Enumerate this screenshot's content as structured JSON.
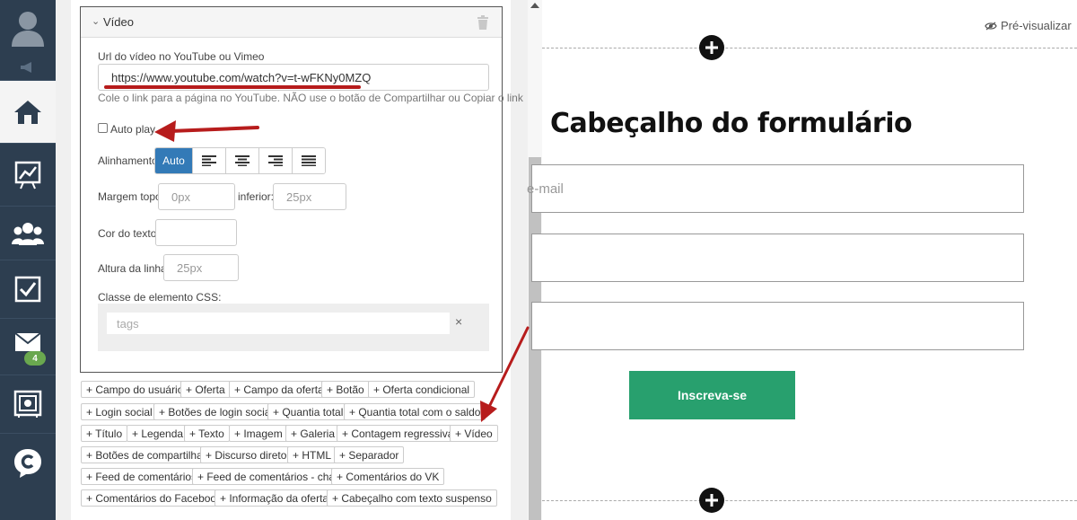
{
  "sidebar": {
    "items": [
      {
        "name": "avatar",
        "icon": "user-avatar-icon"
      },
      {
        "name": "announce",
        "icon": "megaphone-icon"
      },
      {
        "name": "home",
        "icon": "home-icon"
      },
      {
        "name": "stats",
        "icon": "chart-icon"
      },
      {
        "name": "contacts",
        "icon": "users-icon"
      },
      {
        "name": "tasks",
        "icon": "checkbox-icon"
      },
      {
        "name": "mail",
        "icon": "mail-icon"
      },
      {
        "name": "safe",
        "icon": "safe-icon"
      },
      {
        "name": "chat",
        "icon": "chat-icon"
      }
    ],
    "mail_badge": "4"
  },
  "video_block": {
    "title": "Vídeo",
    "url_label": "Url do vídeo no YouTube ou Vimeo",
    "url_value": "https://www.youtube.com/watch?v=t-wFKNy0MZQ",
    "url_hint": "Cole o link para a página no YouTube. NÃO use o botão de Compartilhar ou Copiar o link",
    "autoplay_label": "Auto play",
    "alignment_label": "Alinhamento",
    "alignment_auto": "Auto",
    "margin_top_label": "Margem topo:",
    "margin_top_placeholder": "0px",
    "margin_bottom_label": "inferior:",
    "margin_bottom_placeholder": "25px",
    "text_color_label": "Cor do texto:",
    "line_height_label": "Altura da linha:",
    "line_height_placeholder": "25px",
    "css_class_label": "Classe de elemento CSS:",
    "tags_placeholder": "tags",
    "tags_clear": "×"
  },
  "elements": [
    "+ Campo do usuário",
    "+ Oferta",
    "+ Campo da oferta",
    "+ Botão",
    "+ Oferta condicional",
    "+ Login social",
    "+ Botões de login social",
    "+ Quantia total",
    "+ Quantia total com o saldo",
    "+ Título",
    "+ Legenda",
    "+ Texto",
    "+ Imagem",
    "+ Galeria",
    "+ Contagem regressiva",
    "+ Vídeo",
    "+ Botões de compartilhar",
    "+ Discurso direto",
    "+ HTML",
    "+ Separador",
    "+ Feed de comentários",
    "+ Feed de comentários - chat",
    "+ Comentários do VK",
    "+ Comentários do Facebook",
    "+ Informação da oferta",
    "+ Cabeçalho com texto suspenso"
  ],
  "canvas": {
    "preview_label": "Pré-visualizar",
    "form_title": "Cabeçalho do formulário",
    "email_placeholder": "e-mail",
    "submit_label": "Inscreva-se"
  },
  "colors": {
    "sidebar": "#2d3e50",
    "accent_blue": "#337ab7",
    "submit_green": "#28a06e",
    "annotation_red": "#b71c1c"
  }
}
